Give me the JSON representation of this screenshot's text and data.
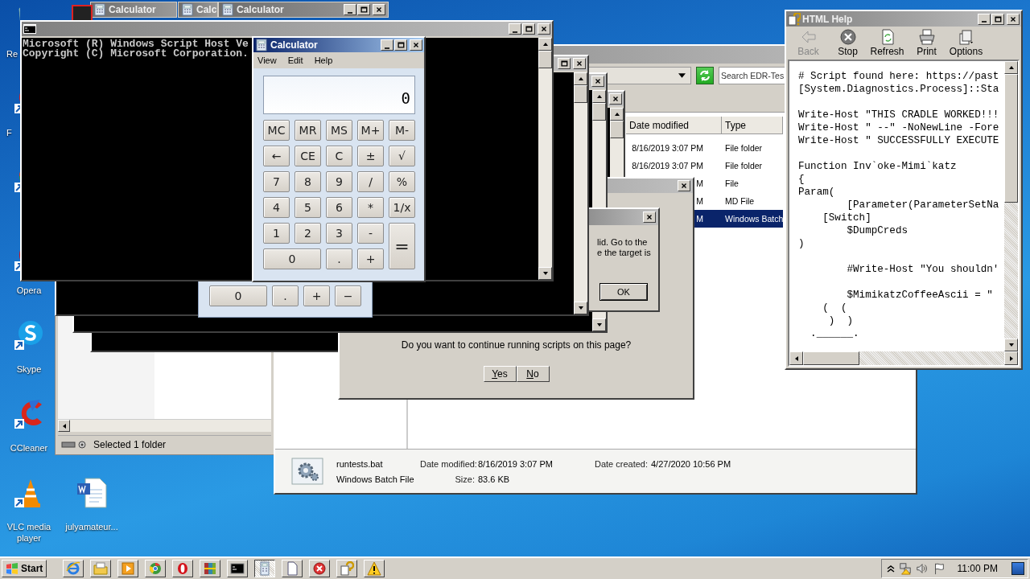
{
  "desktop": {
    "column_1": [
      {
        "label": "Re",
        "kind": "recycle",
        "clipped": true,
        "label_cut": true
      },
      {
        "label": "F",
        "kind": "app",
        "clipped": true,
        "label_cut": true
      },
      {
        "kind": "chrome",
        "clipped": true
      },
      {
        "label": "Opera",
        "kind": "opera",
        "clipped": true,
        "label_cut": false
      },
      {
        "label": "Skype",
        "kind": "skype",
        "clipped": false,
        "label_cut": false
      },
      {
        "label": "CCleaner",
        "kind": "ccleaner",
        "clipped": false,
        "label_cut": false
      },
      {
        "label": "VLC media player",
        "kind": "vlc",
        "clipped": false,
        "label_cut": false
      }
    ],
    "column_2": [
      {
        "label": "julyamateur...",
        "kind": "word"
      }
    ]
  },
  "top_calculator_titles": [
    {
      "title": "Calculator"
    },
    {
      "title": "Calc"
    },
    {
      "title": "Calculator",
      "controls": true
    }
  ],
  "explorer_back": {
    "status": "Selected 1 folder"
  },
  "explorer": {
    "search": {
      "placeholder": "Search EDR-Tes"
    },
    "columns": [
      "Date modified",
      "Type"
    ],
    "rows": [
      {
        "date": "8/16/2019 3:07 PM",
        "type": "File folder",
        "selected": false
      },
      {
        "date": "8/16/2019 3:07 PM",
        "type": "File folder",
        "selected": false
      },
      {
        "date": "M",
        "type": "File",
        "selected": false
      },
      {
        "date": "M",
        "type": "MD File",
        "selected": false
      },
      {
        "date": "M",
        "type": "Windows Batch",
        "selected": true
      }
    ],
    "details": {
      "name": "runtests.bat",
      "type": "Windows Batch File",
      "fields": [
        {
          "label": "Date modified:",
          "value": "8/16/2019 3:07 PM"
        },
        {
          "label": "Size:",
          "value": "83.6 KB"
        },
        {
          "label": "Date created:",
          "value": "4/27/2020 10:56 PM"
        }
      ]
    }
  },
  "script_dialog": {
    "message": "Do you want to continue running scripts on this page?",
    "buttons": [
      "Yes",
      "No"
    ]
  },
  "ok_dialog": {
    "lines": [
      "lid. Go to the",
      "e the target is"
    ],
    "button": "OK"
  },
  "console": {
    "lines": [
      "Microsoft (R) Windows Script Host Ve",
      "Copyright (C) Microsoft Corporation."
    ]
  },
  "back_calculator": {
    "keys": [
      {
        "label": "0",
        "kind": "wide"
      },
      {
        "label": ".",
        "kind": "std"
      },
      {
        "label": "+",
        "kind": "std"
      },
      {
        "label": "−",
        "kind": "std"
      }
    ]
  },
  "calculator": {
    "title": "Calculator",
    "menu": [
      "View",
      "Edit",
      "Help"
    ],
    "display": "0",
    "keys": [
      {
        "label": "MC",
        "kind": "std"
      },
      {
        "label": "MR",
        "kind": "std"
      },
      {
        "label": "MS",
        "kind": "std"
      },
      {
        "label": "M+",
        "kind": "std"
      },
      {
        "label": "M-",
        "kind": "std"
      },
      {
        "label": "←",
        "kind": "std"
      },
      {
        "label": "CE",
        "kind": "std"
      },
      {
        "label": "C",
        "kind": "std"
      },
      {
        "label": "±",
        "kind": "std"
      },
      {
        "label": "√",
        "kind": "std"
      },
      {
        "label": "7",
        "kind": "std"
      },
      {
        "label": "8",
        "kind": "std"
      },
      {
        "label": "9",
        "kind": "std"
      },
      {
        "label": "/",
        "kind": "std"
      },
      {
        "label": "%",
        "kind": "std"
      },
      {
        "label": "4",
        "kind": "std"
      },
      {
        "label": "5",
        "kind": "std"
      },
      {
        "label": "6",
        "kind": "std"
      },
      {
        "label": "*",
        "kind": "std"
      },
      {
        "label": "1/x",
        "kind": "std"
      },
      {
        "label": "1",
        "kind": "std"
      },
      {
        "label": "2",
        "kind": "std"
      },
      {
        "label": "3",
        "kind": "std"
      },
      {
        "label": "-",
        "kind": "std"
      },
      {
        "label": "=",
        "kind": "tall"
      },
      {
        "label": "0",
        "kind": "wide"
      },
      {
        "label": ".",
        "kind": "std"
      },
      {
        "label": "+",
        "kind": "std"
      }
    ]
  },
  "help": {
    "title": "HTML Help",
    "toolbar": [
      {
        "label": "Back",
        "kind": "back",
        "disabled": true
      },
      {
        "label": "Stop",
        "kind": "stop",
        "disabled": false
      },
      {
        "label": "Refresh",
        "kind": "refresh",
        "disabled": false
      },
      {
        "label": "Print",
        "kind": "print",
        "disabled": false
      },
      {
        "label": "Options",
        "kind": "options",
        "disabled": false
      }
    ],
    "code_blocks": [
      [
        "# Script found here: https://past",
        "[System.Diagnostics.Process]::Sta"
      ],
      [
        "Write-Host \"THIS CRADLE WORKED!!!",
        "Write-Host \" --\" -NoNewLine -Fore",
        "Write-Host \" SUCCESSFULLY EXECUTE"
      ],
      [
        "Function Inv`oke-Mimi`katz",
        "{",
        "Param(",
        "        [Parameter(ParameterSetNa",
        "    [Switch]",
        "        $DumpCreds",
        ")"
      ],
      [
        "        #Write-Host \"You shouldn'"
      ],
      [
        "        $MimikatzCoffeeAscii = \"",
        "    (  (",
        "     )  )",
        "  .______."
      ]
    ]
  },
  "taskbar": {
    "start": "Start",
    "apps": [
      {
        "kind": "ie",
        "selected": false
      },
      {
        "kind": "folder",
        "selected": false
      },
      {
        "kind": "media",
        "selected": false
      },
      {
        "kind": "chrome",
        "selected": false
      },
      {
        "kind": "opera",
        "selected": false
      },
      {
        "kind": "archive",
        "selected": false
      },
      {
        "kind": "cmd",
        "selected": false
      },
      {
        "kind": "calculator",
        "selected": true
      },
      {
        "kind": "document",
        "selected": false
      },
      {
        "kind": "error",
        "selected": false
      },
      {
        "kind": "help",
        "selected": false
      },
      {
        "kind": "warning",
        "selected": false
      }
    ],
    "clock": "11:00 PM"
  }
}
